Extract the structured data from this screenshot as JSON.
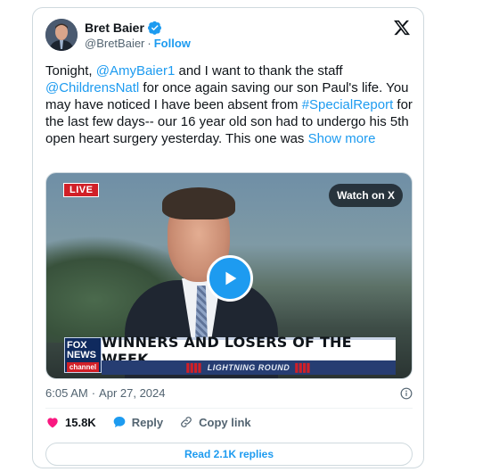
{
  "author": {
    "name": "Bret Baier",
    "handle": "@BretBaier",
    "separator": "·",
    "follow_label": "Follow"
  },
  "tweet": {
    "segments": [
      {
        "text": "Tonight, ",
        "link": false
      },
      {
        "text": "@AmyBaier1",
        "link": true
      },
      {
        "text": " and I want to thank the staff ",
        "link": false
      },
      {
        "text": "@ChildrensNatl",
        "link": true
      },
      {
        "text": " for once again saving our son Paul's life. You may have noticed I have been absent from ",
        "link": false
      },
      {
        "text": "#SpecialReport",
        "link": true
      },
      {
        "text": " for the last few days-- our 16 year old son had to undergo his 5th open heart surgery yesterday. This one was ",
        "link": false
      },
      {
        "text": "Show more",
        "link": true
      }
    ]
  },
  "media": {
    "live_label": "LIVE",
    "watch_label": "Watch on X",
    "fox_logo_line1": "FOX",
    "fox_logo_line2": "NEWS",
    "fox_logo_line3": "channel",
    "banner_headline": "WINNERS AND LOSERS OF THE WEEK",
    "banner_sub": "LIGHTNING ROUND"
  },
  "meta": {
    "time": "6:05 AM",
    "separator": "·",
    "date": "Apr 27, 2024"
  },
  "actions": {
    "likes_count": "15.8K",
    "reply_label": "Reply",
    "copy_link_label": "Copy link"
  },
  "read_replies_label": "Read 2.1K replies",
  "colors": {
    "accent": "#1d9bf0",
    "like": "#f91880",
    "text": "#0f1419",
    "muted": "#536471",
    "border": "#cfd9de"
  }
}
